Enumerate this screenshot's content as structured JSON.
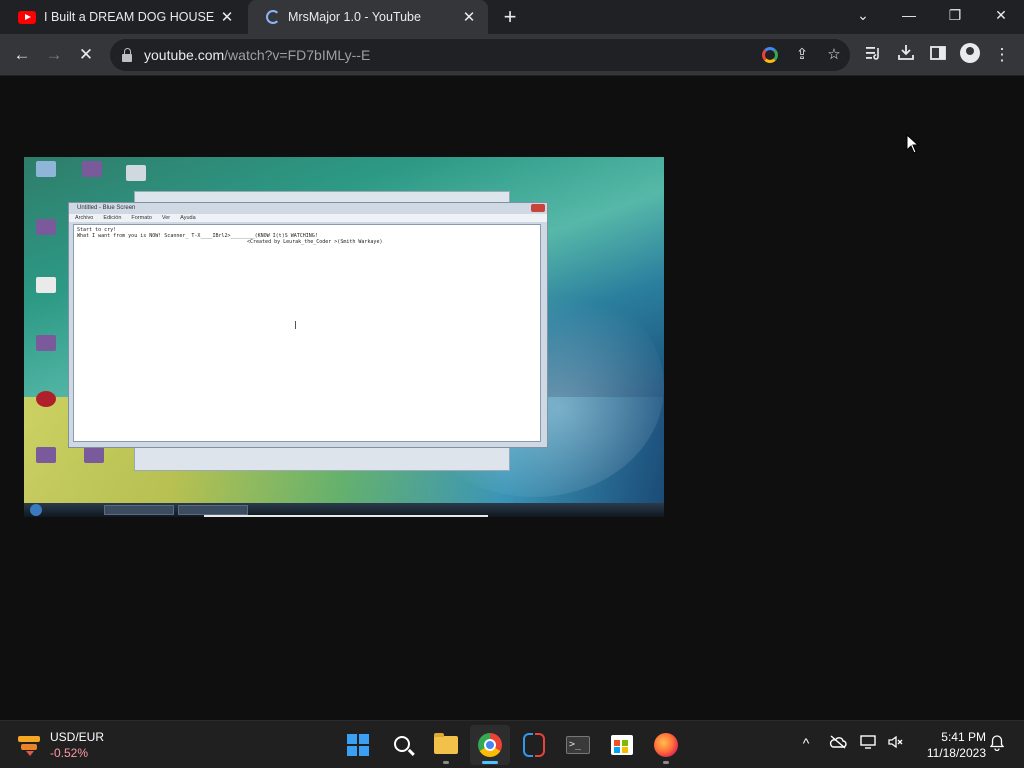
{
  "browser": {
    "tabs": [
      {
        "title": "I Built a DREAM DOG HOUSE and",
        "favicon": "youtube-icon",
        "active": false
      },
      {
        "title": "MrsMajor 1.0 - YouTube",
        "favicon": "loading-spinner-icon",
        "active": true
      }
    ],
    "new_tab": "+",
    "window_controls": {
      "list": "⌄",
      "minimize": "—",
      "restore": "❐",
      "close": "✕"
    },
    "nav": {
      "back": "←",
      "forward": "→",
      "stop": "✕"
    },
    "address": {
      "host": "youtube.com",
      "path": "/watch?v=FD7bIMLy--E"
    },
    "omnibox_icons": {
      "share": "⇪",
      "bookmark": "☆"
    },
    "toolbar_icons": {
      "menu": "⋮"
    }
  },
  "video": {
    "notepad": {
      "title": "Untitled - Blue Screen",
      "menu": [
        "Archivo",
        "Edición",
        "Formato",
        "Ver",
        "Ayuda"
      ],
      "lines": [
        "Start to cry!",
        "What I want from you is NOW! Scanner_ T-X____IBrl2>________(KNOW I(t)S WATCHING!",
        "<Created by Leurak_the_Coder >(Smith Warkaye)"
      ]
    }
  },
  "taskbar": {
    "widget": {
      "symbol": "USD/EUR",
      "change": "-0.52%"
    },
    "apps": [
      {
        "name": "start-button",
        "active": false
      },
      {
        "name": "search-button",
        "active": false
      },
      {
        "name": "file-explorer-app",
        "active": false
      },
      {
        "name": "chrome-app",
        "active": true
      },
      {
        "name": "switch-app",
        "active": false
      },
      {
        "name": "terminal-app",
        "active": false
      },
      {
        "name": "store-app",
        "active": false
      },
      {
        "name": "firefox-app",
        "active": false
      }
    ],
    "tray": {
      "chevron": "^",
      "notification": "🔔"
    },
    "clock": {
      "time": "5:41 PM",
      "date": "11/18/2023"
    }
  }
}
